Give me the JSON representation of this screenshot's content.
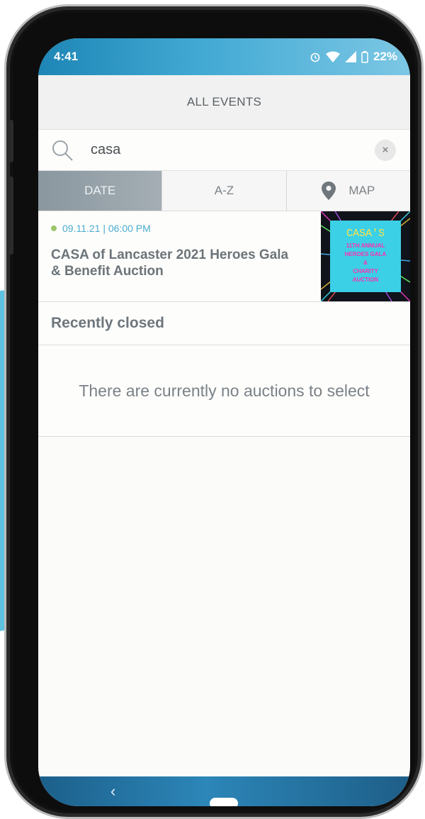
{
  "status": {
    "time": "4:41",
    "battery": "22%"
  },
  "header": {
    "title": "ALL EVENTS"
  },
  "search": {
    "value": "casa",
    "clear_label": "×"
  },
  "tabs": [
    {
      "label": "DATE"
    },
    {
      "label": "A-Z"
    },
    {
      "label": "MAP"
    }
  ],
  "events": [
    {
      "date": "09.11.21 | 06:00 PM",
      "title_line1": "CASA of Lancaster 2021 Heroes Gala",
      "title_line2": "& Benefit Auction",
      "thumb": {
        "brand": "CASA'S",
        "line1": "11TH ANNUAL",
        "line2": "HEROES GALA",
        "line3": "&",
        "line4": "CHARITY",
        "line5": "AUCTION"
      }
    }
  ],
  "recently_closed": {
    "title": "Recently closed",
    "empty_message": "There are currently no auctions to select"
  },
  "nav": {
    "back_label": "‹"
  },
  "colors": {
    "accent": "#4aaccf",
    "status_dot": "#9cc56a",
    "thumb_bg": "#3bd0e6",
    "thumb_text": "#ff2fb0"
  }
}
